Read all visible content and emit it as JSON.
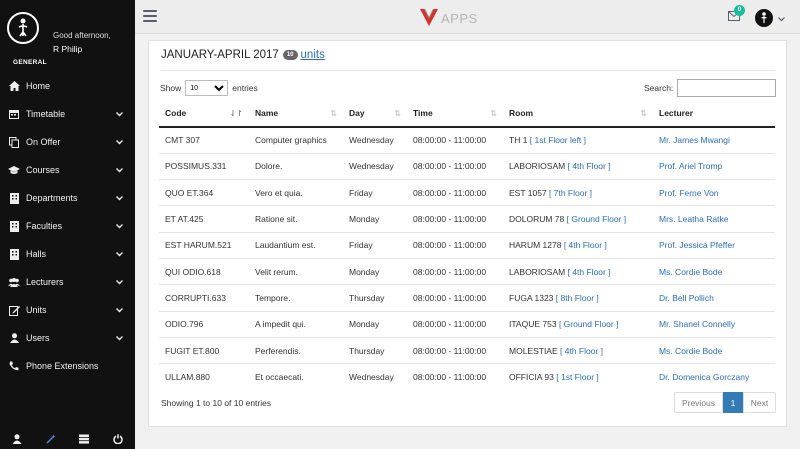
{
  "sidebar": {
    "greeting": "Good afternoon,",
    "user_name": "R Philip",
    "role": "GENERAL",
    "items": [
      {
        "label": "Home",
        "icon": "home-icon",
        "has_submenu": false
      },
      {
        "label": "Timetable",
        "icon": "calendar-icon",
        "has_submenu": true
      },
      {
        "label": "On Offer",
        "icon": "copy-icon",
        "has_submenu": true
      },
      {
        "label": "Courses",
        "icon": "graduation-cap-icon",
        "has_submenu": true
      },
      {
        "label": "Departments",
        "icon": "building-icon",
        "has_submenu": true
      },
      {
        "label": "Faculties",
        "icon": "building-icon",
        "has_submenu": true
      },
      {
        "label": "Halls",
        "icon": "building-icon",
        "has_submenu": true
      },
      {
        "label": "Lecturers",
        "icon": "users-icon",
        "has_submenu": true
      },
      {
        "label": "Units",
        "icon": "edit-icon",
        "has_submenu": true
      },
      {
        "label": "Users",
        "icon": "user-icon",
        "has_submenu": true
      },
      {
        "label": "Phone Extensions",
        "icon": "phone-icon",
        "has_submenu": false
      }
    ],
    "footer_icons": [
      "user-icon",
      "wand-icon",
      "server-icon",
      "power-icon"
    ]
  },
  "topbar": {
    "brand_text": "APPS",
    "notification_count": "0"
  },
  "panel": {
    "title": "JANUARY-APRIL 2017",
    "count": "10",
    "title_link": "units",
    "show_label": "Show",
    "page_size": "10",
    "entries_label": "entries",
    "search_label": "Search:",
    "search_value": "",
    "columns": [
      "Code",
      "Name",
      "Day",
      "Time",
      "Room",
      "Lecturer"
    ],
    "rows": [
      {
        "code": "CMT 307",
        "name": "Computer graphics",
        "day": "Wednesday",
        "time": "08:00:00 - 11:00:00",
        "room": "TH 1",
        "floor": "[ 1st Floor left ]",
        "lecturer": "Mr. James Mwangi"
      },
      {
        "code": "POSSIMUS.331",
        "name": "Dolore.",
        "day": "Wednesday",
        "time": "08:00:00 - 11:00:00",
        "room": "LABORIOSAM",
        "floor": "[ 4th Floor ]",
        "lecturer": "Prof. Ariel Tromp"
      },
      {
        "code": "QUO ET.364",
        "name": "Vero et quia.",
        "day": "Friday",
        "time": "08:00:00 - 11:00:00",
        "room": "EST 1057",
        "floor": "[ 7th Floor ]",
        "lecturer": "Prof. Ferne Von"
      },
      {
        "code": "ET AT.425",
        "name": "Ratione sit.",
        "day": "Monday",
        "time": "08:00:00 - 11:00:00",
        "room": "DOLORUM 78",
        "floor": "[ Ground Floor ]",
        "lecturer": "Mrs. Leatha Ratke"
      },
      {
        "code": "EST HARUM.521",
        "name": "Laudantium est.",
        "day": "Friday",
        "time": "08:00:00 - 11:00:00",
        "room": "HARUM 1278",
        "floor": "[ 4th Floor ]",
        "lecturer": "Prof. Jessica Pfeffer"
      },
      {
        "code": "QUI ODIO.618",
        "name": "Velit rerum.",
        "day": "Monday",
        "time": "08:00:00 - 11:00:00",
        "room": "LABORIOSAM",
        "floor": "[ 4th Floor ]",
        "lecturer": "Ms. Cordie Bode"
      },
      {
        "code": "CORRUPTI.633",
        "name": "Tempore.",
        "day": "Thursday",
        "time": "08:00:00 - 11:00:00",
        "room": "FUGA 1323",
        "floor": "[ 8th Floor ]",
        "lecturer": "Dr. Bell Pollich"
      },
      {
        "code": "ODIO.796",
        "name": "A impedit qui.",
        "day": "Monday",
        "time": "08:00:00 - 11:00:00",
        "room": "ITAQUE 753",
        "floor": "[ Ground Floor ]",
        "lecturer": "Mr. Shanel Connelly"
      },
      {
        "code": "FUGIT ET.800",
        "name": "Perferendis.",
        "day": "Thursday",
        "time": "08:00:00 - 11:00:00",
        "room": "MOLESTIAE",
        "floor": "[ 4th Floor ]",
        "lecturer": "Ms. Cordie Bode"
      },
      {
        "code": "ULLAM.880",
        "name": "Et occaecati.",
        "day": "Wednesday",
        "time": "08:00:00 - 11:00:00",
        "room": "OFFICIA 93",
        "floor": "[ 1st Floor ]",
        "lecturer": "Dr. Domenica Gorczany"
      }
    ],
    "info": "Showing 1 to 10 of 10 entries",
    "pager": {
      "prev": "Previous",
      "current": "1",
      "next": "Next"
    }
  },
  "colors": {
    "sidebar_bg": "#111111",
    "link": "#2a6ebb",
    "active_page": "#337ab7",
    "badge": "#1bbc9b"
  }
}
